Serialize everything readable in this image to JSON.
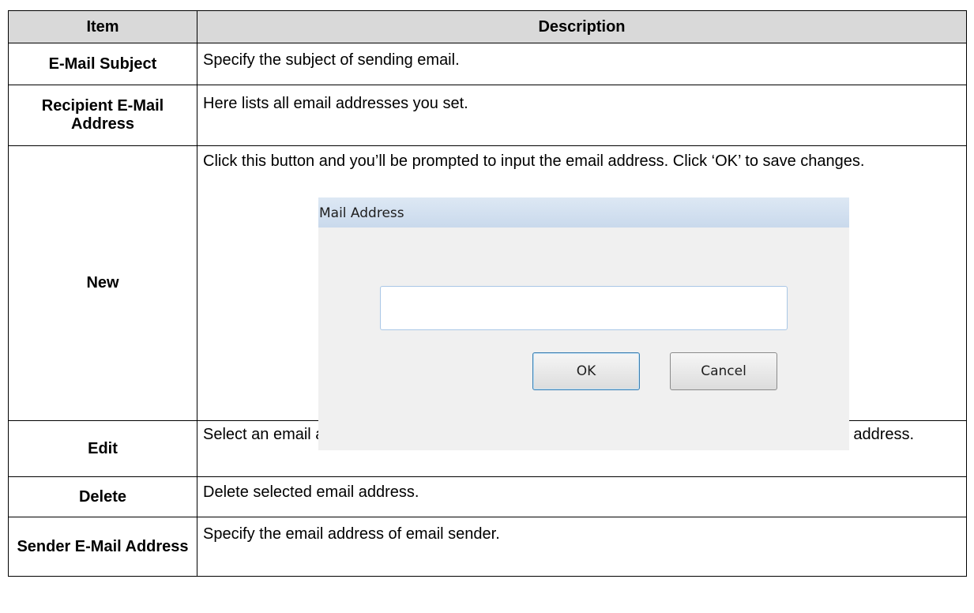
{
  "table": {
    "headers": {
      "item": "Item",
      "description": "Description"
    },
    "rows": [
      {
        "item": "E-Mail Subject",
        "description": "Specify the subject of sending email."
      },
      {
        "item": "Recipient E-Mail Address",
        "description": "Here lists all email addresses you set."
      },
      {
        "item": "New",
        "description": "Click this button and you’ll be prompted to input the email address. Click ‘OK’ to save changes."
      },
      {
        "item": "Edit",
        "description": "Select an email address from ‘Recipient E-Mail Address’ box, and click ‘Edit’ to edit the email address."
      },
      {
        "item": "Delete",
        "description": "Delete selected email address."
      },
      {
        "item": "Sender E-Mail Address",
        "description": "Specify the email address of email sender."
      }
    ]
  },
  "dialog": {
    "title": "Mail Address",
    "input_value": "",
    "ok_label": "OK",
    "cancel_label": "Cancel",
    "colors": {
      "titlebar": "#c9d9ec",
      "body": "#f0f0f0",
      "field_border": "#a9c7e6",
      "ok_border": "#3c7fb1"
    }
  }
}
